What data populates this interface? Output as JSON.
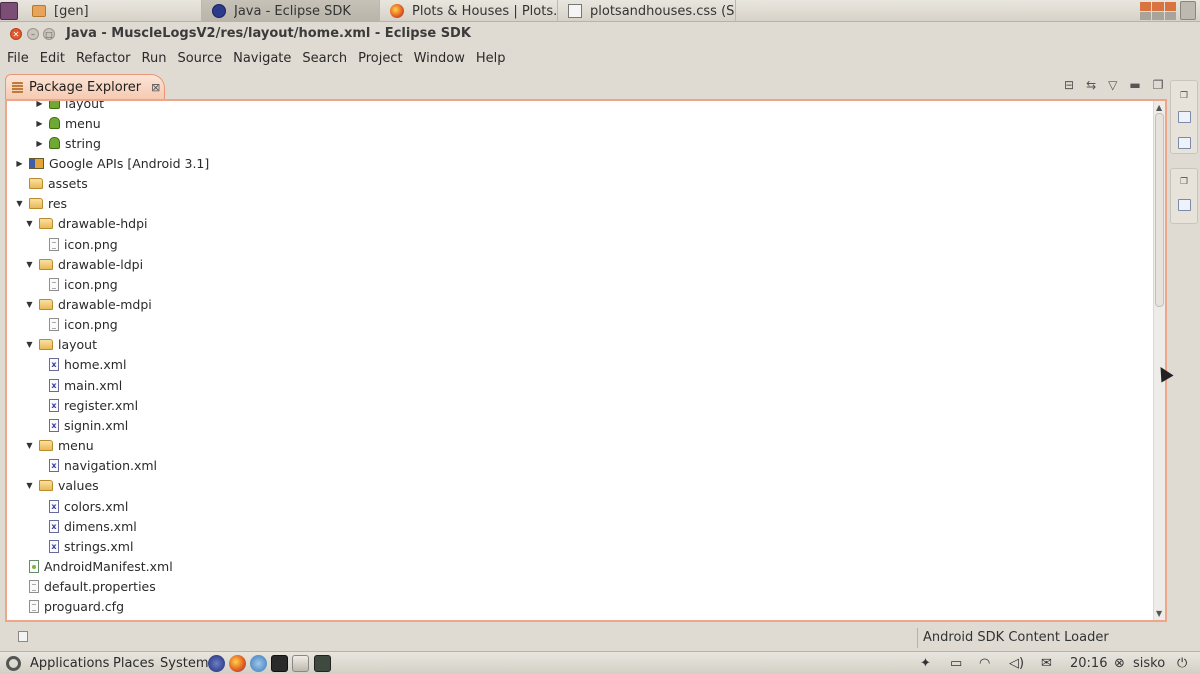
{
  "taskbar": {
    "tabs": [
      {
        "label": "[gen]",
        "icon": "folder-icon"
      },
      {
        "label": "Java - Eclipse SDK",
        "icon": "eclipse-icon",
        "active": true
      },
      {
        "label": "Plots & Houses | Plots...",
        "icon": "firefox-icon"
      },
      {
        "label": "plotsandhouses.css (S...",
        "icon": "text-editor-icon"
      }
    ]
  },
  "window": {
    "title": "Java - MuscleLogsV2/res/layout/home.xml - Eclipse SDK"
  },
  "menu": {
    "items": [
      "File",
      "Edit",
      "Refactor",
      "Run",
      "Source",
      "Navigate",
      "Search",
      "Project",
      "Window",
      "Help"
    ]
  },
  "view": {
    "tab_title": "Package Explorer",
    "close_glyph": "⊠"
  },
  "tree": {
    "rows": [
      {
        "label": "layout",
        "depth": 2,
        "expander": "collapsed",
        "icon": "values-icon"
      },
      {
        "label": "menu",
        "depth": 2,
        "expander": "collapsed",
        "icon": "values-icon"
      },
      {
        "label": "string",
        "depth": 2,
        "expander": "collapsed",
        "icon": "values-icon"
      },
      {
        "label": "Google APIs [Android 3.1]",
        "depth": 0,
        "expander": "collapsed",
        "icon": "library-icon"
      },
      {
        "label": "assets",
        "depth": 0,
        "expander": "none",
        "icon": "folder-icon"
      },
      {
        "label": "res",
        "depth": 0,
        "expander": "expanded",
        "icon": "folder-icon"
      },
      {
        "label": "drawable-hdpi",
        "depth": 1,
        "expander": "expanded",
        "icon": "folder-icon"
      },
      {
        "label": "icon.png",
        "depth": 2,
        "expander": "none",
        "icon": "file-icon"
      },
      {
        "label": "drawable-ldpi",
        "depth": 1,
        "expander": "expanded",
        "icon": "folder-icon"
      },
      {
        "label": "icon.png",
        "depth": 2,
        "expander": "none",
        "icon": "file-icon"
      },
      {
        "label": "drawable-mdpi",
        "depth": 1,
        "expander": "expanded",
        "icon": "folder-icon"
      },
      {
        "label": "icon.png",
        "depth": 2,
        "expander": "none",
        "icon": "file-icon"
      },
      {
        "label": "layout",
        "depth": 1,
        "expander": "expanded",
        "icon": "folder-icon"
      },
      {
        "label": "home.xml",
        "depth": 2,
        "expander": "none",
        "icon": "xml-file-icon"
      },
      {
        "label": "main.xml",
        "depth": 2,
        "expander": "none",
        "icon": "xml-file-icon"
      },
      {
        "label": "register.xml",
        "depth": 2,
        "expander": "none",
        "icon": "xml-file-icon"
      },
      {
        "label": "signin.xml",
        "depth": 2,
        "expander": "none",
        "icon": "xml-file-icon"
      },
      {
        "label": "menu",
        "depth": 1,
        "expander": "expanded",
        "icon": "folder-icon"
      },
      {
        "label": "navigation.xml",
        "depth": 2,
        "expander": "none",
        "icon": "xml-file-icon"
      },
      {
        "label": "values",
        "depth": 1,
        "expander": "expanded",
        "icon": "folder-icon"
      },
      {
        "label": "colors.xml",
        "depth": 2,
        "expander": "none",
        "icon": "xml-file-icon"
      },
      {
        "label": "dimens.xml",
        "depth": 2,
        "expander": "none",
        "icon": "xml-file-icon"
      },
      {
        "label": "strings.xml",
        "depth": 2,
        "expander": "none",
        "icon": "xml-file-icon"
      },
      {
        "label": "AndroidManifest.xml",
        "depth": 0,
        "expander": "none",
        "icon": "manifest-icon"
      },
      {
        "label": "default.properties",
        "depth": 0,
        "expander": "none",
        "icon": "file-icon"
      },
      {
        "label": "proguard.cfg",
        "depth": 0,
        "expander": "none",
        "icon": "file-icon"
      }
    ]
  },
  "status": {
    "text": "Android SDK Content Loader"
  },
  "panel": {
    "menus": [
      "Applications",
      "Places",
      "System"
    ],
    "clock": "20:16",
    "user": "sisko"
  },
  "colors": {
    "active_view_border": "#eea68a",
    "close_button": "#e0592d",
    "panel_bg": "#dfdbd2"
  }
}
